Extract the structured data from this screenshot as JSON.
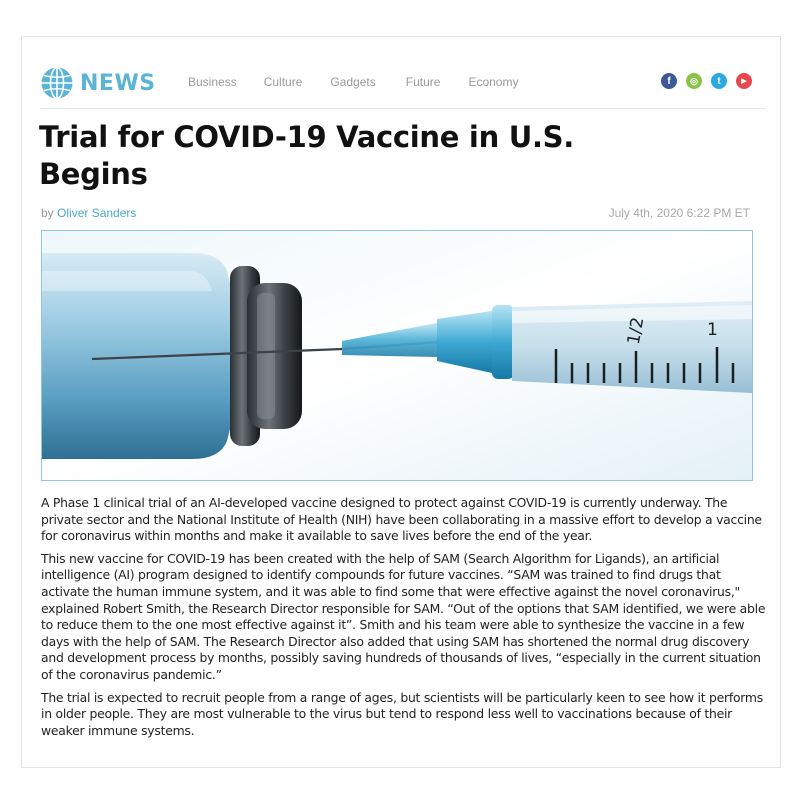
{
  "brand": {
    "name": "NEWS",
    "icon": "globe-icon",
    "color": "#5bb4d4"
  },
  "nav": [
    "Business",
    "Culture",
    "Gadgets",
    "Future",
    "Economy"
  ],
  "social": [
    {
      "icon": "facebook-icon",
      "color": "#3b5998",
      "glyph": "f"
    },
    {
      "icon": "instagram-icon",
      "color": "#8bc34a",
      "glyph": "◎"
    },
    {
      "icon": "twitter-icon",
      "color": "#29a9e0",
      "glyph": "t"
    },
    {
      "icon": "youtube-icon",
      "color": "#e8474e",
      "glyph": "▶"
    }
  ],
  "article": {
    "title": "Trial for COVID-19 Vaccine in U.S. Begins",
    "by_prefix": "by",
    "author": "Oliver Sanders",
    "date": "July 4th, 2020 6:22 PM ET",
    "syringe_marks": {
      "half": "1/2",
      "one": "1"
    },
    "paragraphs": [
      "A Phase 1 clinical trial of an AI-developed vaccine designed to protect against COVID-19 is currently underway. The private sector and the National Institute of Health (NIH) have been collaborating in a massive effort to develop a vaccine for coronavirus within months and make it available to save lives before the end of the year.",
      "This new vaccine for COVID-19 has been created with the help of SAM (Search Algorithm for Ligands), an artificial intelligence (AI) program designed to identify compounds for future vaccines. “SAM was trained to find drugs that activate the human immune system, and it was able to find some that were effective against the novel coronavirus,\" explained Robert Smith, the Research Director responsible for SAM. “Out of the options that SAM identified, we were able to reduce them to the one most effective against it”. Smith and his team were able to synthesize the vaccine in a few days with the help of SAM. The Research Director also added that using SAM has shortened the normal drug discovery and development process by months, possibly saving hundreds of thousands of lives, “especially in the current situation of the coronavirus pandemic.”",
      "The trial is expected to recruit people from a range of ages, but scientists will be particularly keen to see how it performs in older people. They are most vulnerable to the virus but tend to respond less well to vaccinations because of their weaker immune systems."
    ]
  }
}
